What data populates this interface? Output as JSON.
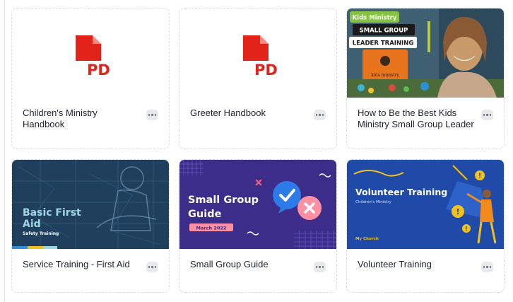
{
  "cards": [
    {
      "title": "Children's Ministry Handbook",
      "thumb_type": "pdf",
      "icon": "pdf-icon"
    },
    {
      "title": "Greeter Handbook",
      "thumb_type": "pdf",
      "icon": "pdf-icon"
    },
    {
      "title": "How to Be the Best Kids Ministry Small Group Leader",
      "thumb_type": "image",
      "thumb": {
        "badge": "Kids Ministry",
        "line1": "SMALL GROUP",
        "line2": "LEADER TRAINING",
        "sign": "kids ministry"
      }
    },
    {
      "title": "Service Training - First Aid",
      "thumb_type": "image",
      "thumb": {
        "line1": "Basic First",
        "line2": "Aid",
        "sub": "Safety Training"
      }
    },
    {
      "title": "Small Group Guide",
      "thumb_type": "image",
      "thumb": {
        "line1": "Small Group",
        "line2": "Guide",
        "date": "March 2022"
      }
    },
    {
      "title": "Volunteer Training",
      "thumb_type": "image",
      "thumb": {
        "line1": "Volunteer Training",
        "sub": "Children's Ministry",
        "footer": "My Church"
      }
    }
  ],
  "pdf_label": "PDF",
  "colors": {
    "pdf_red": "#e2231a",
    "card_border": "#dcdcdc",
    "title_text": "#1e2230"
  }
}
